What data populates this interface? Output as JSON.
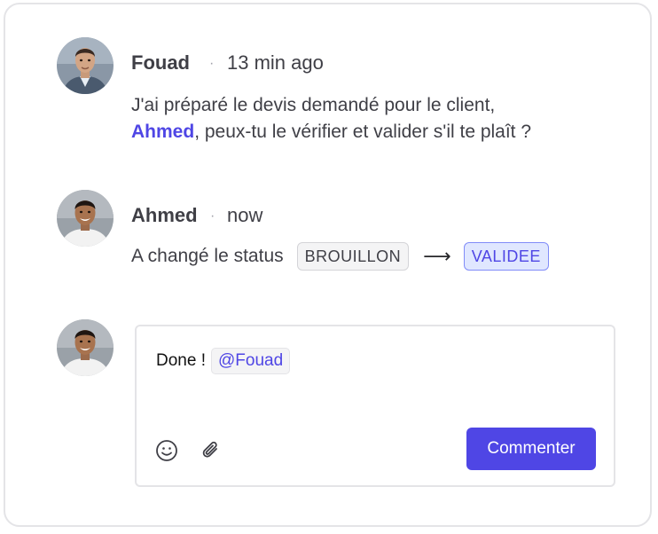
{
  "comments": [
    {
      "author": "Fouad",
      "separator": "·",
      "time": "13 min ago",
      "text_before": "J'ai préparé le devis demandé pour le client,",
      "mention": "Ahmed",
      "text_after": ", peux-tu le vérifier et valider s'il te plaît ?",
      "avatar_icon": "user-avatar-fouad"
    },
    {
      "author": "Ahmed",
      "separator": "·",
      "time": "now",
      "status_text": "A changé le status",
      "from_status": "BROUILLON",
      "arrow": "⟶",
      "to_status": "VALIDEE",
      "avatar_icon": "user-avatar-ahmed"
    }
  ],
  "composer": {
    "text": "Done !",
    "mention": "@Fouad",
    "emoji_icon": "smiley-icon",
    "attach_icon": "paperclip-icon",
    "submit_label": "Commenter"
  },
  "colors": {
    "accent": "#4f46e5",
    "text": "#3f3f46",
    "border": "#e4e4e7",
    "badge_to_bg": "#e0e7ff"
  }
}
